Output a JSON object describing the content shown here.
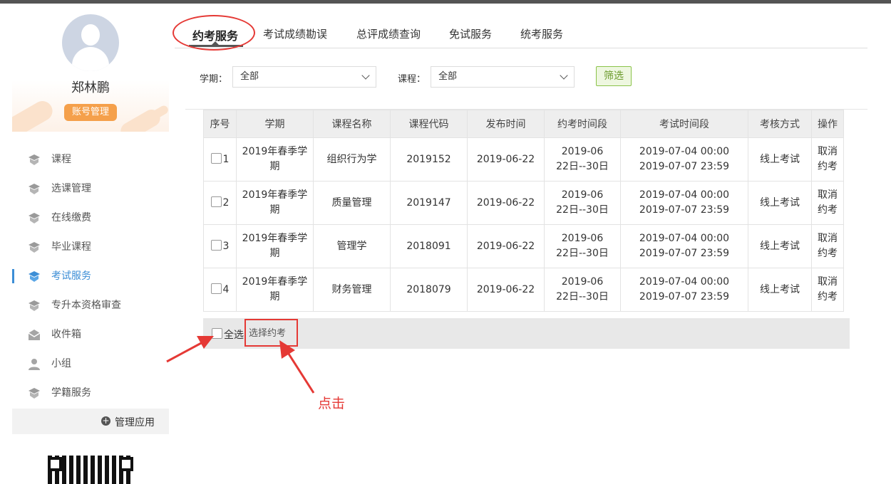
{
  "sidebar": {
    "username": "郑林鹏",
    "account_button": "账号管理",
    "menu": [
      {
        "label": "课程",
        "icon": "course-icon"
      },
      {
        "label": "选课管理",
        "icon": "course-select-icon"
      },
      {
        "label": "在线缴费",
        "icon": "payment-icon"
      },
      {
        "label": "毕业课程",
        "icon": "graduation-icon"
      },
      {
        "label": "考试服务",
        "icon": "exam-icon",
        "active": true
      },
      {
        "label": "专升本资格审查",
        "icon": "review-icon"
      },
      {
        "label": "收件箱",
        "icon": "inbox-icon"
      },
      {
        "label": "小组",
        "icon": "group-icon"
      },
      {
        "label": "学籍服务",
        "icon": "student-status-icon"
      }
    ],
    "manage_apps": "管理应用",
    "manage_icon": "plus-circle-icon"
  },
  "tabs": [
    {
      "label": "约考服务",
      "active": true
    },
    {
      "label": "考试成绩勘误"
    },
    {
      "label": "总评成绩查询"
    },
    {
      "label": "免试服务"
    },
    {
      "label": "统考服务"
    }
  ],
  "filters": {
    "term_label": "学期：",
    "term_value": "全部",
    "course_label": "课程：",
    "course_value": "全部",
    "filter_button": "筛选"
  },
  "table": {
    "headers": [
      "序号",
      "学期",
      "课程名称",
      "课程代码",
      "发布时间",
      "约考时间段",
      "考试时间段",
      "考核方式",
      "操作"
    ],
    "rows": [
      {
        "no": "1",
        "term": [
          "2019年春季学",
          "期"
        ],
        "course": "组织行为学",
        "code": "2019152",
        "publish": "2019-06-22",
        "book_period": [
          "2019-06",
          "22日--30日"
        ],
        "exam_period": [
          "2019-07-04 00:00",
          "2019-07-07 23:59"
        ],
        "method": "线上考试",
        "action": [
          "取消",
          "约考"
        ]
      },
      {
        "no": "2",
        "term": [
          "2019年春季学",
          "期"
        ],
        "course": "质量管理",
        "code": "2019147",
        "publish": "2019-06-22",
        "book_period": [
          "2019-06",
          "22日--30日"
        ],
        "exam_period": [
          "2019-07-04 00:00",
          "2019-07-07 23:59"
        ],
        "method": "线上考试",
        "action": [
          "取消",
          "约考"
        ]
      },
      {
        "no": "3",
        "term": [
          "2019年春季学",
          "期"
        ],
        "course": "管理学",
        "code": "2018091",
        "publish": "2019-06-22",
        "book_period": [
          "2019-06",
          "22日--30日"
        ],
        "exam_period": [
          "2019-07-04 00:00",
          "2019-07-07 23:59"
        ],
        "method": "线上考试",
        "action": [
          "取消",
          "约考"
        ]
      },
      {
        "no": "4",
        "term": [
          "2019年春季学",
          "期"
        ],
        "course": "财务管理",
        "code": "2018079",
        "publish": "2019-06-22",
        "book_period": [
          "2019-06",
          "22日--30日"
        ],
        "exam_period": [
          "2019-07-04 00:00",
          "2019-07-07 23:59"
        ],
        "method": "线上考试",
        "action": [
          "取消",
          "约考"
        ]
      }
    ]
  },
  "bottom": {
    "select_all": "全选",
    "choose_button": "选择约考"
  },
  "annotation": {
    "text": "点击",
    "color": "#e53935"
  },
  "colors": {
    "accent": "#3c8ed6",
    "account_button": "#f5a04b",
    "filter_button": "#8bc34a"
  }
}
